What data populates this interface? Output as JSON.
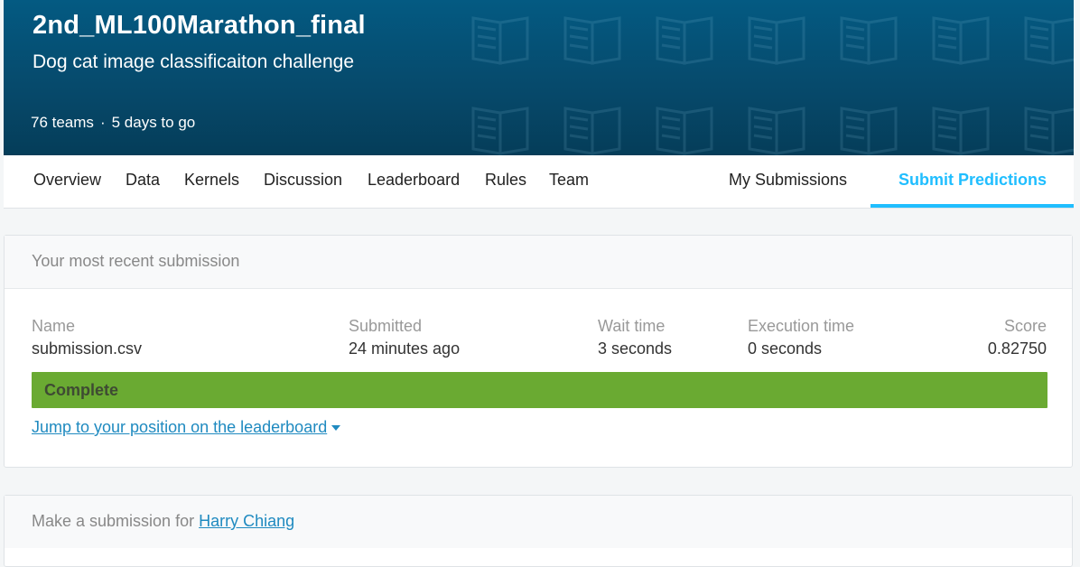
{
  "competition": {
    "title": "2nd_ML100Marathon_final",
    "subtitle": "Dog cat image classificaiton challenge",
    "teams": "76 teams",
    "separator": "·",
    "deadline": "5 days to go"
  },
  "nav": {
    "tabs": [
      "Overview",
      "Data",
      "Kernels",
      "Discussion",
      "Leaderboard",
      "Rules",
      "Team"
    ],
    "my_submissions": "My Submissions",
    "submit_predictions": "Submit Predictions"
  },
  "recent": {
    "heading": "Your most recent submission",
    "columns": {
      "name_label": "Name",
      "name_value": "submission.csv",
      "submitted_label": "Submitted",
      "submitted_value": "24 minutes ago",
      "wait_label": "Wait time",
      "wait_value": "3 seconds",
      "exec_label": "Execution time",
      "exec_value": "0 seconds",
      "score_label": "Score",
      "score_value": "0.82750"
    },
    "status": "Complete",
    "status_color": "#6aaa32",
    "jump_link": "Jump to your position on the leaderboard"
  },
  "make_submission": {
    "prefix": "Make a submission for",
    "user": "Harry Chiang"
  },
  "colors": {
    "banner": "#045a82",
    "accent": "#20beff",
    "link": "#1f8ac0"
  }
}
